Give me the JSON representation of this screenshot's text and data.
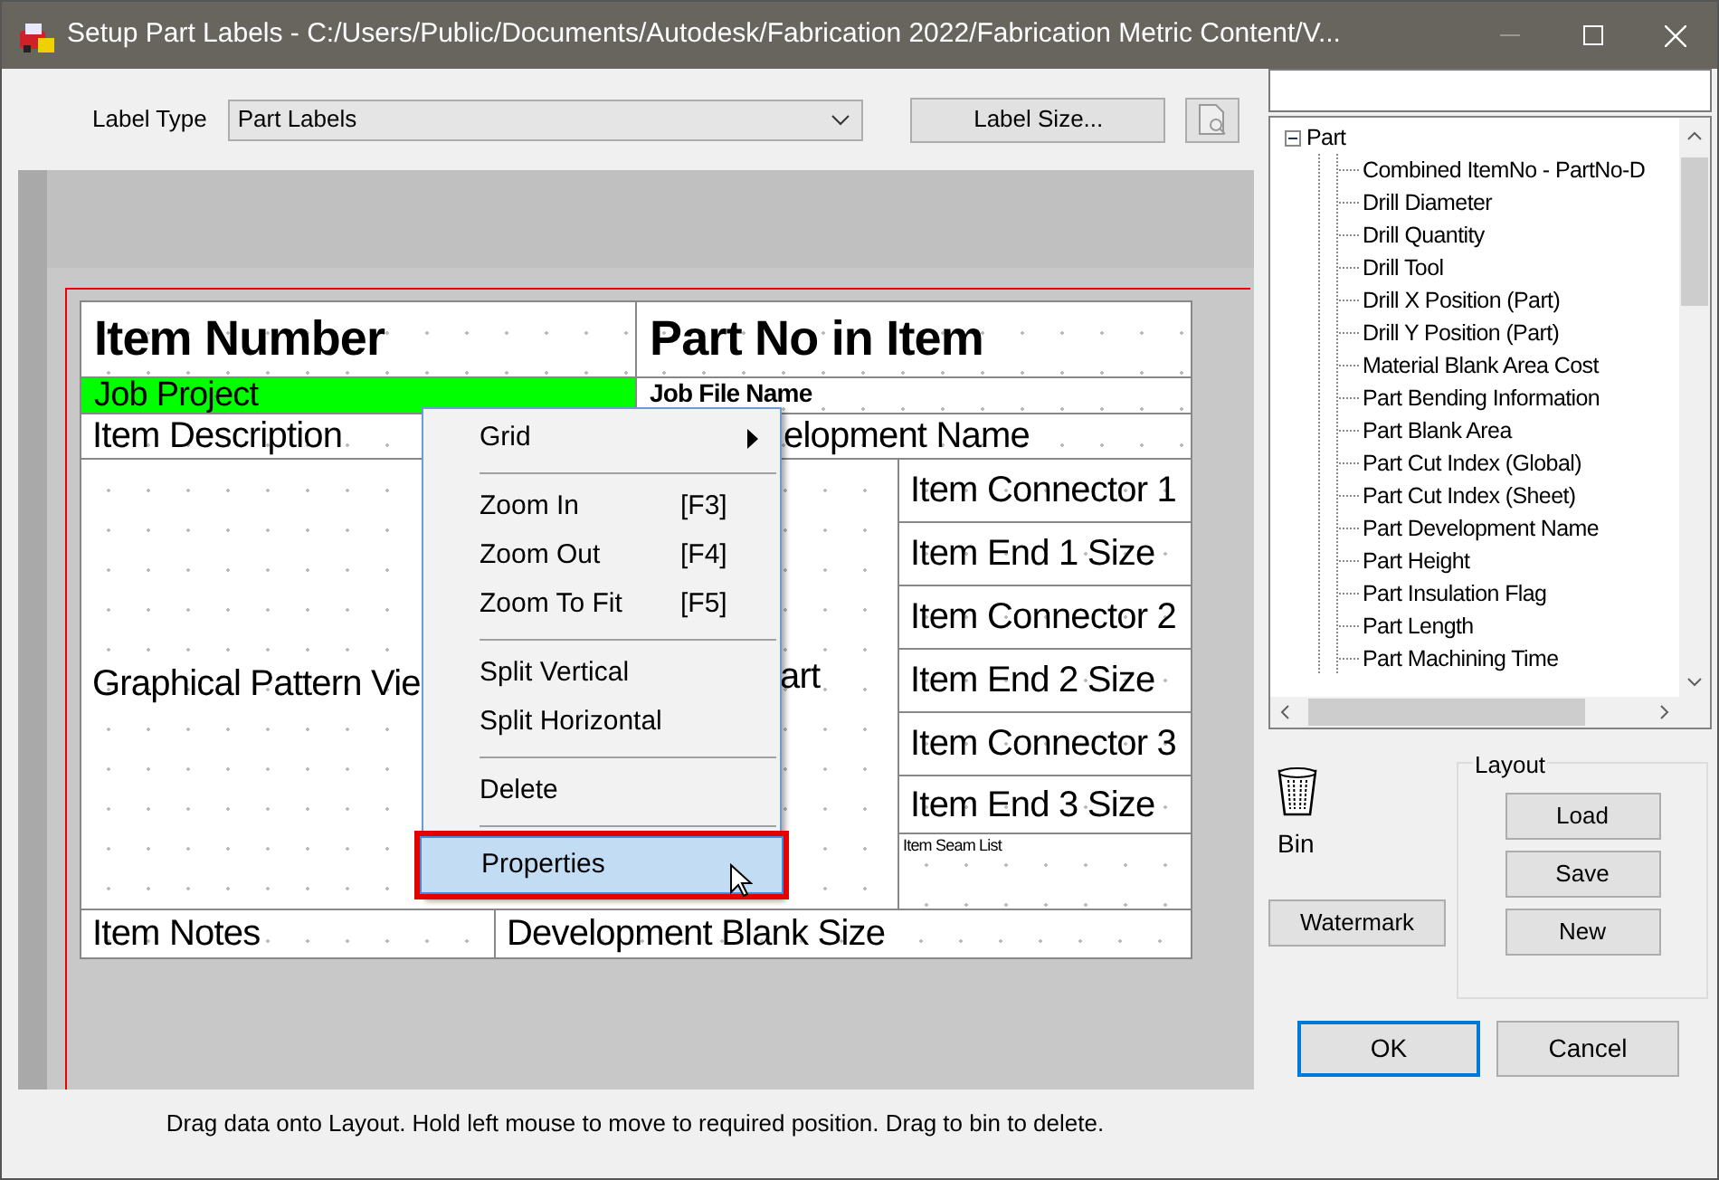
{
  "window": {
    "title": "Setup Part Labels - C:/Users/Public/Documents/Autodesk/Fabrication 2022/Fabrication Metric Content/V..."
  },
  "label_type": {
    "label": "Label Type",
    "value": "Part Labels"
  },
  "label_size_button": "Label Size...",
  "layout_fields": [
    {
      "text": "Item Number",
      "kind": "heading"
    },
    {
      "text": "Part No in Item",
      "kind": "heading"
    },
    {
      "text": "Job Project",
      "kind": "highlight"
    },
    {
      "text": "Job File Name",
      "kind": "subheading"
    },
    {
      "text": "Item Description",
      "kind": "normal"
    },
    {
      "text": "elopment Name",
      "kind": "normal"
    },
    {
      "text": "Graphical Pattern Vie",
      "kind": "normal"
    },
    {
      "text": "art",
      "kind": "normal"
    },
    {
      "text": "Item Connector 1",
      "kind": "normal"
    },
    {
      "text": "Item End 1 Size",
      "kind": "normal"
    },
    {
      "text": "Item Connector 2",
      "kind": "normal"
    },
    {
      "text": "Item End 2 Size",
      "kind": "normal"
    },
    {
      "text": "Item Connector 3",
      "kind": "normal"
    },
    {
      "text": "Item End 3 Size",
      "kind": "normal"
    },
    {
      "text": "Item Seam List",
      "kind": "small"
    },
    {
      "text": "Item Notes",
      "kind": "normal"
    },
    {
      "text": "Development Blank Size",
      "kind": "normal"
    }
  ],
  "context_menu": [
    {
      "kind": "item",
      "label": "Grid",
      "submenu": true,
      "selected": false
    },
    {
      "kind": "separator"
    },
    {
      "kind": "item",
      "label": "Zoom In",
      "shortcut": "[F3]",
      "selected": false
    },
    {
      "kind": "item",
      "label": "Zoom Out",
      "shortcut": "[F4]",
      "selected": false
    },
    {
      "kind": "item",
      "label": "Zoom To Fit",
      "shortcut": "[F5]",
      "selected": false
    },
    {
      "kind": "separator"
    },
    {
      "kind": "item",
      "label": "Split Vertical",
      "selected": false
    },
    {
      "kind": "item",
      "label": "Split Horizontal",
      "selected": false
    },
    {
      "kind": "separator"
    },
    {
      "kind": "item",
      "label": "Delete",
      "selected": false
    },
    {
      "kind": "separator"
    },
    {
      "kind": "item",
      "label": "Properties",
      "selected": true
    }
  ],
  "status": "Drag data onto Layout. Hold left mouse to move to required position. Drag to bin to delete.",
  "tree": {
    "label": "Part",
    "expanded": true,
    "children": [
      {
        "label": "Combined ItemNo - PartNo-D"
      },
      {
        "label": "Drill Diameter"
      },
      {
        "label": "Drill Quantity"
      },
      {
        "label": "Drill Tool"
      },
      {
        "label": "Drill X Position (Part)"
      },
      {
        "label": "Drill Y Position (Part)"
      },
      {
        "label": "Material Blank Area Cost"
      },
      {
        "label": "Part Bending Information"
      },
      {
        "label": "Part Blank Area"
      },
      {
        "label": "Part Cut Index (Global)"
      },
      {
        "label": "Part Cut Index (Sheet)"
      },
      {
        "label": "Part Development Name"
      },
      {
        "label": "Part Height"
      },
      {
        "label": "Part Insulation Flag"
      },
      {
        "label": "Part Length"
      },
      {
        "label": "Part Machining Time"
      }
    ]
  },
  "bin": {
    "label": "Bin"
  },
  "watermark_button": "Watermark",
  "layout_group": {
    "title": "Layout",
    "buttons": [
      "Load",
      "Save",
      "New"
    ]
  },
  "dialog_buttons": [
    {
      "label": "OK",
      "focused": true
    },
    {
      "label": "Cancel",
      "focused": false
    }
  ]
}
